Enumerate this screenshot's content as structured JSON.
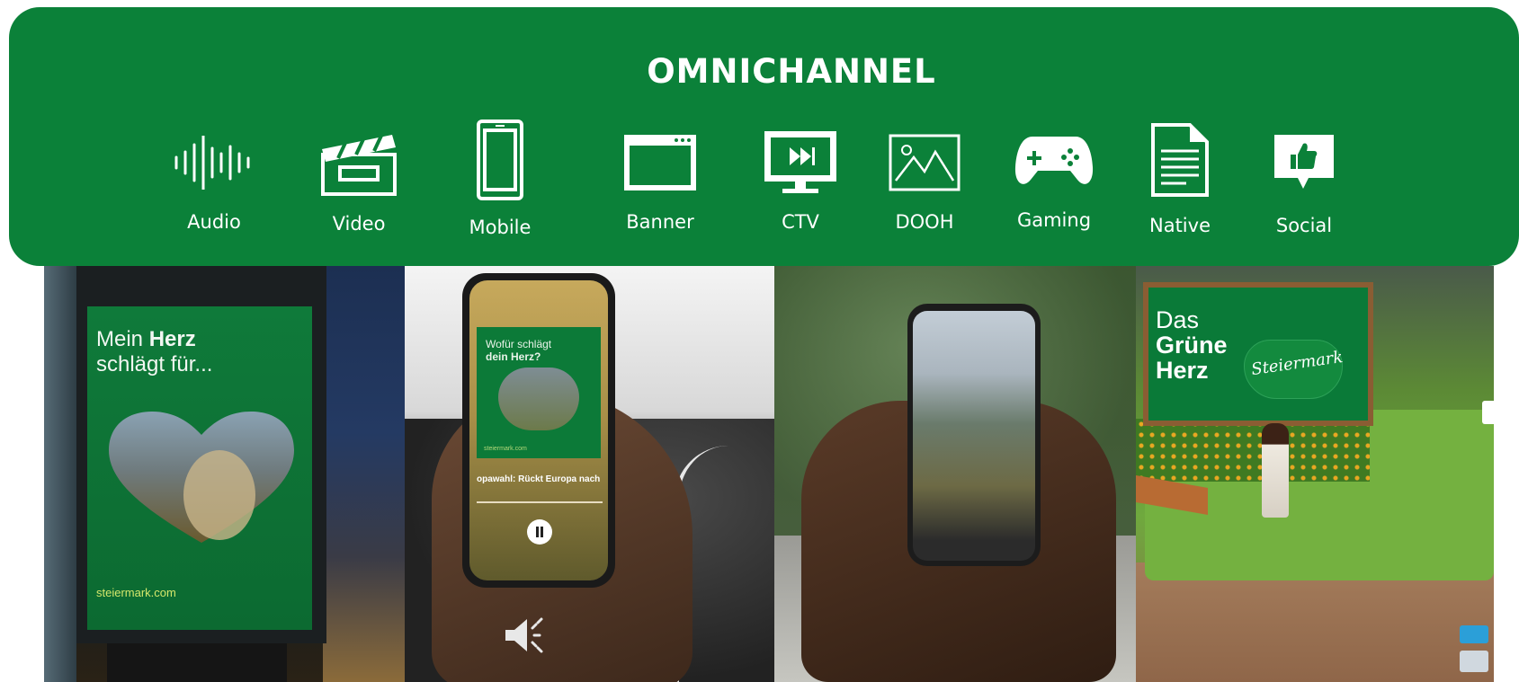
{
  "banner": {
    "title": "OMNICHANNEL",
    "color": "#0b8139",
    "channels": [
      {
        "label": "Audio",
        "icon": "audio-waveform-icon"
      },
      {
        "label": "Video",
        "icon": "clapperboard-icon"
      },
      {
        "label": "Mobile",
        "icon": "smartphone-icon"
      },
      {
        "label": "Banner",
        "icon": "browser-window-icon"
      },
      {
        "label": "CTV",
        "icon": "tv-fast-forward-icon"
      },
      {
        "label": "DOOH",
        "icon": "landscape-image-icon"
      },
      {
        "label": "Gaming",
        "icon": "gamepad-icon"
      },
      {
        "label": "Native",
        "icon": "document-icon"
      },
      {
        "label": "Social",
        "icon": "thumbs-up-speech-icon"
      }
    ]
  },
  "photos": {
    "poster": {
      "line1_prefix": "Mein ",
      "line1_bold": "Herz",
      "line2": "schlägt für...",
      "url": "steiermark.com"
    },
    "podcast": {
      "art_line1": "Wofür schlägt",
      "art_line2": "dein Herz?",
      "art_url": "steiermark.com",
      "track": "opawahl: Rückt Europa nach"
    },
    "game": {
      "line1": "Das",
      "line2": "Grüne",
      "line3": "Herz",
      "brand": "Steiermark"
    }
  }
}
